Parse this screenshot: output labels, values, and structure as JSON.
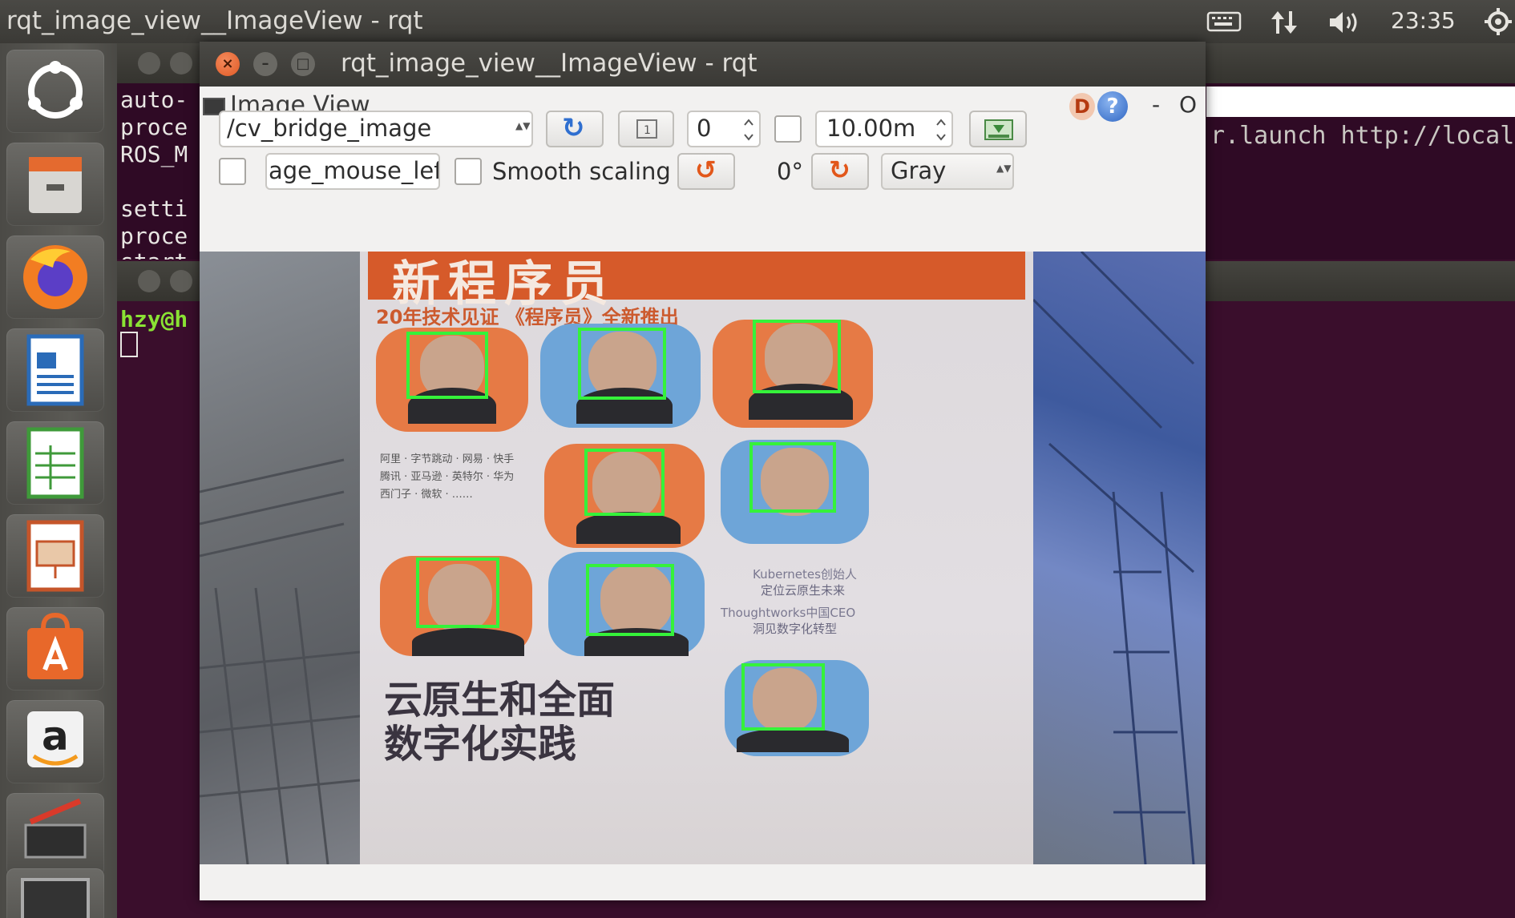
{
  "topbar": {
    "title": "rqt_image_view__ImageView - rqt",
    "time": "23:35",
    "indicators": [
      "keyboard-icon",
      "network-icon",
      "volume-icon",
      "settings-gear-icon"
    ]
  },
  "launcher": {
    "items": [
      "ubuntu-dash-icon",
      "files-icon",
      "firefox-icon",
      "writer-icon",
      "calc-icon",
      "impress-icon",
      "software-center-icon",
      "amazon-icon",
      "system-settings-icon",
      "terminal-icon"
    ],
    "amazon_glyph": "a"
  },
  "terminal1": {
    "lines": [
      "auto-",
      "proce",
      "ROS_M",
      "",
      "setti",
      "proce",
      "start"
    ],
    "url_fragment": "r.launch http://localho"
  },
  "terminal2": {
    "prompt": "hzy@h"
  },
  "window": {
    "title": "rqt_image_view__ImageView - rqt",
    "close_symbol": "×",
    "min_symbol": "–",
    "max_symbol": "□"
  },
  "plugin": {
    "title": "Image View",
    "help_d": "D",
    "help_q": "?",
    "min_symbol": "-",
    "close_symbol": "O"
  },
  "toolbar": {
    "topic": "/cv_bridge_image",
    "spin_value": "0",
    "distance_value": "10.00m",
    "mouse_topic": "age_mouse_left",
    "smooth_label": "Smooth scaling",
    "rotation": "0°",
    "color_scheme": "Gray",
    "dropdown_arrow": "▲▼",
    "refresh_glyph": "↻",
    "rotate_left_glyph": "↺",
    "rotate_right_glyph": "↻"
  },
  "poster": {
    "header": "新程序员",
    "subtitle": "20年技术见证 《程序员》全新推出",
    "bottom_line1": "云原生和全面",
    "bottom_line2": "数字化实践",
    "side_note_1": "Kubernetes创始人",
    "side_note_2": "定位云原生未来",
    "side_note_3": "Thoughtworks中国CEO",
    "side_note_4": "洞见数字化转型",
    "left_notes": [
      "阿里 · 字节跳动 · 网易 · 快手",
      "腾讯 · 亚马逊 · 英特尔 · 华为",
      "西门子 · 微软 · ……"
    ],
    "face_detections_count": 8
  },
  "colors": {
    "detection_box": "#35f23a",
    "close_button": "#e05a25",
    "terminal_bg": "#3a0e2c"
  }
}
